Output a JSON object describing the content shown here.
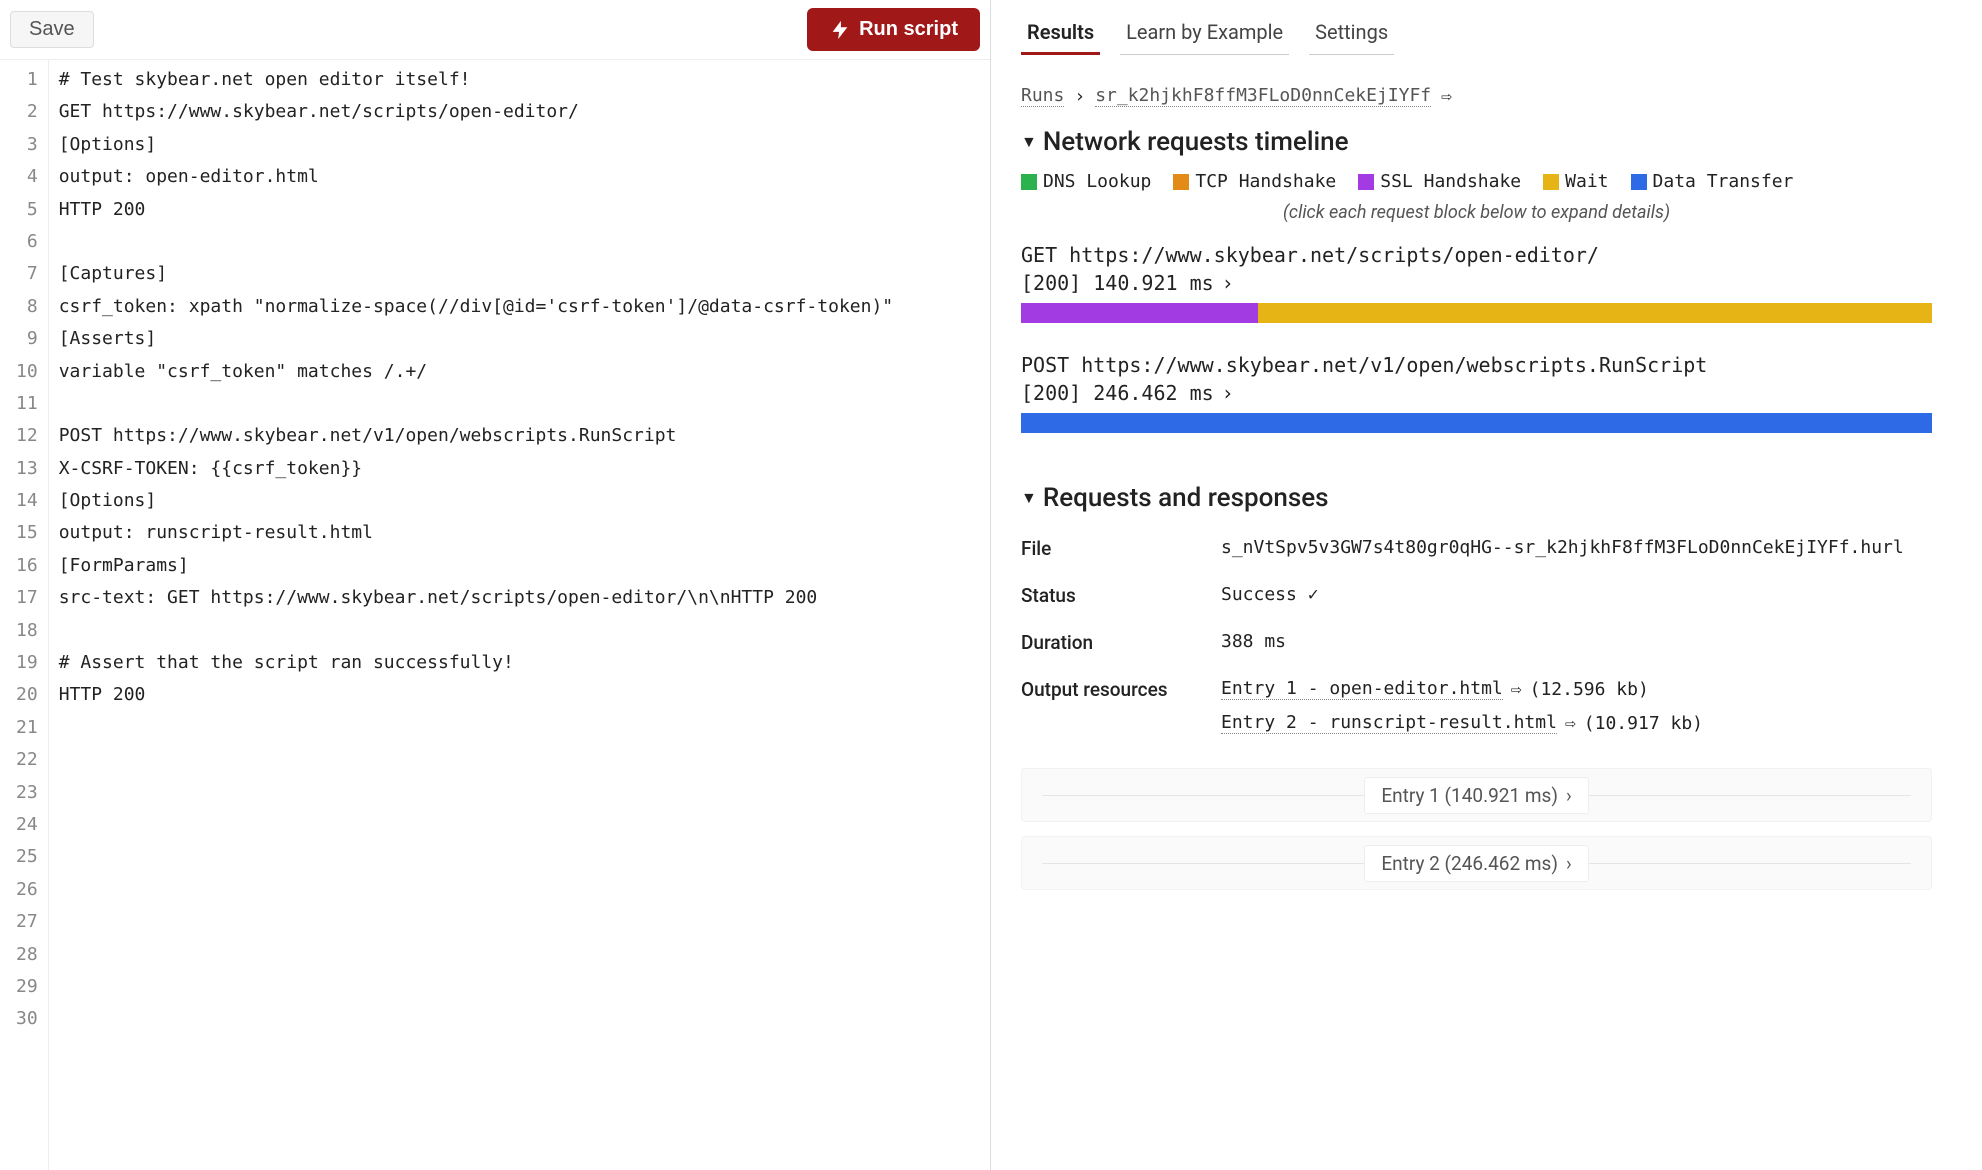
{
  "toolbar": {
    "save_label": "Save",
    "run_label": "Run script"
  },
  "editor": {
    "lines": [
      "# Test skybear.net open editor itself!",
      "GET https://www.skybear.net/scripts/open-editor/",
      "[Options]",
      "output: open-editor.html",
      "HTTP 200",
      "",
      "[Captures]",
      "csrf_token: xpath \"normalize-space(//div[@id='csrf-token']/@data-csrf-token)\"",
      "[Asserts]",
      "variable \"csrf_token\" matches /.+/",
      "",
      "POST https://www.skybear.net/v1/open/webscripts.RunScript",
      "X-CSRF-TOKEN: {{csrf_token}}",
      "[Options]",
      "output: runscript-result.html",
      "[FormParams]",
      "src-text: GET https://www.skybear.net/scripts/open-editor/\\n\\nHTTP 200",
      "",
      "# Assert that the script ran successfully!",
      "HTTP 200",
      "",
      "",
      "",
      "",
      "",
      "",
      "",
      "",
      "",
      ""
    ]
  },
  "tabs": {
    "results": "Results",
    "learn": "Learn by Example",
    "settings": "Settings"
  },
  "breadcrumb": {
    "root": "Runs",
    "run_id": "sr_k2hjkhF8ffM3FLoD0nnCekEjIYFf"
  },
  "timeline": {
    "title": "Network requests timeline",
    "legend": {
      "dns": {
        "label": "DNS Lookup",
        "color": "#2bb24c"
      },
      "tcp": {
        "label": "TCP Handshake",
        "color": "#e38b17"
      },
      "ssl": {
        "label": "SSL Handshake",
        "color": "#a33be3"
      },
      "wait": {
        "label": "Wait",
        "color": "#e7b416"
      },
      "data": {
        "label": "Data Transfer",
        "color": "#2e6ae6"
      }
    },
    "hint": "(click each request block below to expand details)",
    "requests": [
      {
        "line": "GET https://www.skybear.net/scripts/open-editor/",
        "status": "[200] 140.921 ms",
        "segments": [
          {
            "color": "#a33be3",
            "pct": 26
          },
          {
            "color": "#e7b416",
            "pct": 74
          }
        ]
      },
      {
        "line": "POST https://www.skybear.net/v1/open/webscripts.RunScript",
        "status": "[200] 246.462 ms",
        "segments": [
          {
            "color": "#2e6ae6",
            "pct": 100
          }
        ]
      }
    ]
  },
  "responses": {
    "title": "Requests and responses",
    "rows": {
      "file_label": "File",
      "file_value": "s_nVtSpv5v3GW7s4t80gr0qHG--sr_k2hjkhF8ffM3FLoD0nnCekEjIYFf.hurl",
      "status_label": "Status",
      "status_value": "Success ✓",
      "duration_label": "Duration",
      "duration_value": "388 ms",
      "resources_label": "Output resources",
      "resources": [
        {
          "link": "Entry 1 - open-editor.html",
          "size": "(12.596 kb)"
        },
        {
          "link": "Entry 2 - runscript-result.html",
          "size": "(10.917 kb)"
        }
      ]
    }
  },
  "entries": [
    {
      "label": "Entry 1 (140.921 ms)"
    },
    {
      "label": "Entry 2 (246.462 ms)"
    }
  ]
}
